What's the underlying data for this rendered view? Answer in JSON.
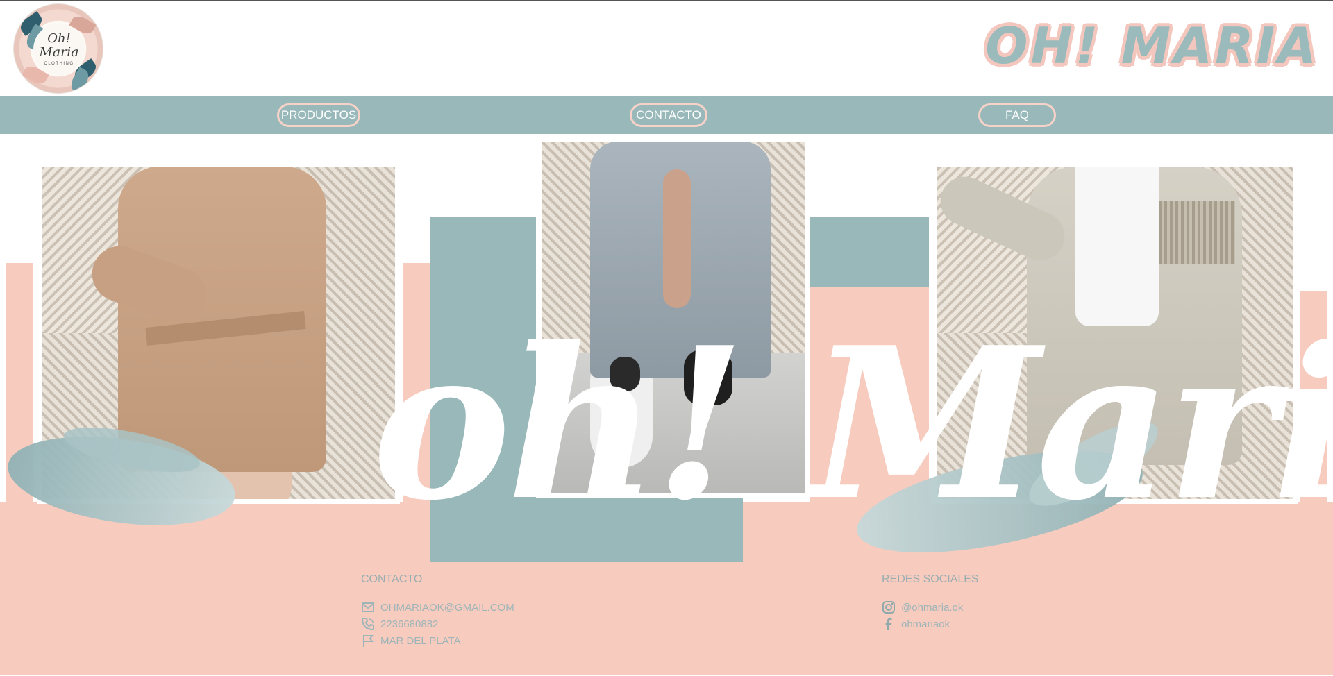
{
  "header": {
    "logo_line1": "Oh!",
    "logo_line2": "Maria",
    "logo_line3": "CLOTHING",
    "brand_title": "OH! MARIA"
  },
  "nav": {
    "items": [
      {
        "label": "PRODUCTOS"
      },
      {
        "label": "CONTACTO"
      },
      {
        "label": "FAQ"
      }
    ]
  },
  "hero": {
    "script_text": "oh! Maria"
  },
  "footer": {
    "contact": {
      "heading": "CONTACTO",
      "email": "OHMARIAOK@GMAIL.COM",
      "phone": "2236680882",
      "location": "MAR DEL PLATA"
    },
    "social": {
      "heading": "REDES SOCIALES",
      "instagram": "@ohmaria.ok",
      "facebook": "ohmariaok"
    }
  },
  "icons": {
    "email": "envelope-icon",
    "phone": "phone-icon",
    "location": "flag-icon",
    "instagram": "instagram-icon",
    "facebook": "facebook-icon"
  },
  "colors": {
    "teal": "#98b8ba",
    "pink": "#f8cbbf",
    "nav_border": "#f6d2c8",
    "footer_text": "#9db5b8"
  }
}
